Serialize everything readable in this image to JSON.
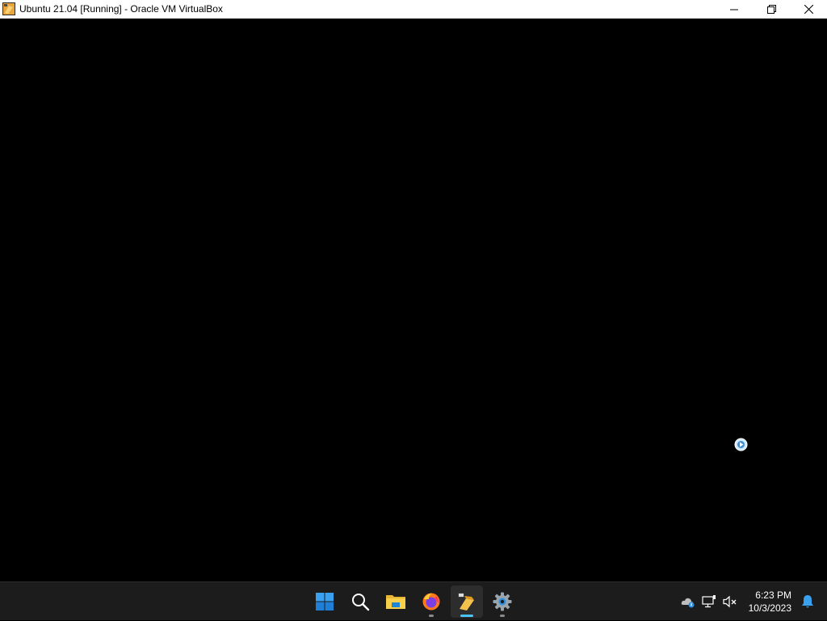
{
  "window": {
    "title": "Ubuntu 21.04 [Running] - Oracle VM VirtualBox",
    "controls": [
      "minimize-icon",
      "restore-icon",
      "close-icon"
    ]
  },
  "vm_display": {
    "background": "#000000",
    "state": "black screen"
  },
  "taskbar": {
    "apps": [
      {
        "name": "Start",
        "icon": "windows-logo-icon",
        "active": false,
        "running": false
      },
      {
        "name": "Search",
        "icon": "search-icon",
        "active": false,
        "running": false
      },
      {
        "name": "File Explorer",
        "icon": "folder-icon",
        "active": false,
        "running": false
      },
      {
        "name": "Firefox",
        "icon": "firefox-icon",
        "active": false,
        "running": true
      },
      {
        "name": "Oracle VM VirtualBox",
        "icon": "virtualbox-icon",
        "active": true,
        "running": true
      },
      {
        "name": "Settings",
        "icon": "gear-icon",
        "active": false,
        "running": true
      }
    ],
    "tray": {
      "icons": [
        "onedrive-icon",
        "network-icon",
        "volume-muted-icon"
      ],
      "time": "6:23 PM",
      "date": "10/3/2023",
      "notification_icon": "bell-icon"
    },
    "accent": "#4cc2ff"
  }
}
